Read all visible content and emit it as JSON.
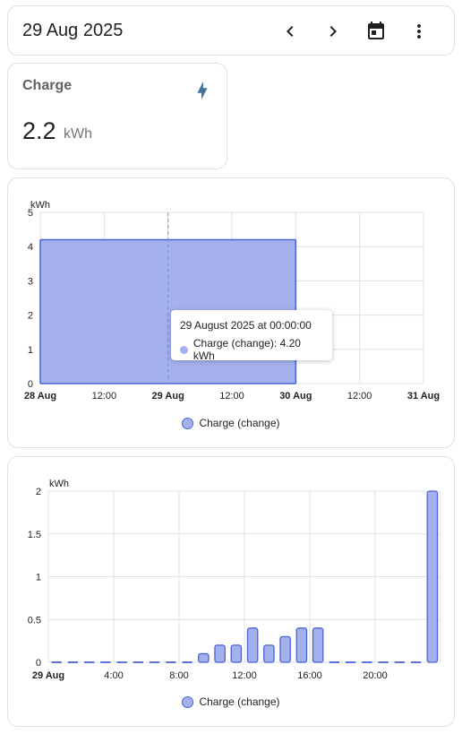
{
  "header": {
    "date": "29 Aug 2025",
    "prev_icon": "chevron-left-icon",
    "next_icon": "chevron-right-icon",
    "calendar_icon": "calendar-icon",
    "menu_icon": "more-vert-icon"
  },
  "stat": {
    "title": "Charge",
    "value": "2.2",
    "unit": "kWh",
    "icon": "lightning-bolt-icon",
    "icon_color": "#44739e"
  },
  "colors": {
    "bar_fill": "#a5b1ec",
    "bar_stroke": "#4a62d6",
    "grid": "#e0e0e0",
    "marker": "#5c9fe0"
  },
  "chart_data": [
    {
      "type": "bar",
      "unit_label": "kWh",
      "y_ticks": [
        "0",
        "1",
        "2",
        "3",
        "4",
        "5"
      ],
      "ylim": [
        0,
        5
      ],
      "x_ticks": [
        {
          "label": "28 Aug",
          "bold": true
        },
        {
          "label": "12:00",
          "bold": false
        },
        {
          "label": "29 Aug",
          "bold": true
        },
        {
          "label": "12:00",
          "bold": false
        },
        {
          "label": "30 Aug",
          "bold": true
        },
        {
          "label": "12:00",
          "bold": false
        },
        {
          "label": "31 Aug",
          "bold": true
        }
      ],
      "series": [
        {
          "name": "Charge (change)",
          "values": [
            4.2,
            4.2,
            4.2,
            4.2
          ]
        }
      ],
      "bar_span": [
        "28 Aug",
        "30 Aug"
      ],
      "hover_marker": "29 Aug",
      "legend": "Charge (change)",
      "tooltip": {
        "title": "29 August 2025 at 00:00:00",
        "line": "Charge (change): 4.20 kWh"
      },
      "grid": true
    },
    {
      "type": "bar",
      "unit_label": "kWh",
      "y_ticks": [
        "0",
        "0.5",
        "1",
        "1.5",
        "2"
      ],
      "ylim": [
        0,
        2
      ],
      "x_ticks": [
        {
          "label": "29 Aug",
          "bold": true
        },
        {
          "label": "4:00",
          "bold": false
        },
        {
          "label": "8:00",
          "bold": false
        },
        {
          "label": "12:00",
          "bold": false
        },
        {
          "label": "16:00",
          "bold": false
        },
        {
          "label": "20:00",
          "bold": false
        }
      ],
      "hours": [
        0,
        1,
        2,
        3,
        4,
        5,
        6,
        7,
        8,
        9,
        10,
        11,
        12,
        13,
        14,
        15,
        16,
        17,
        18,
        19,
        20,
        21,
        22,
        23
      ],
      "series": [
        {
          "name": "Charge (change)",
          "values": [
            0,
            0,
            0,
            0,
            0,
            0,
            0,
            0,
            0,
            0.1,
            0.2,
            0.2,
            0.4,
            0.2,
            0.3,
            0.4,
            0.4,
            0,
            0,
            0,
            0,
            0,
            0,
            2.0
          ]
        }
      ],
      "legend": "Charge (change)",
      "grid": true
    }
  ]
}
